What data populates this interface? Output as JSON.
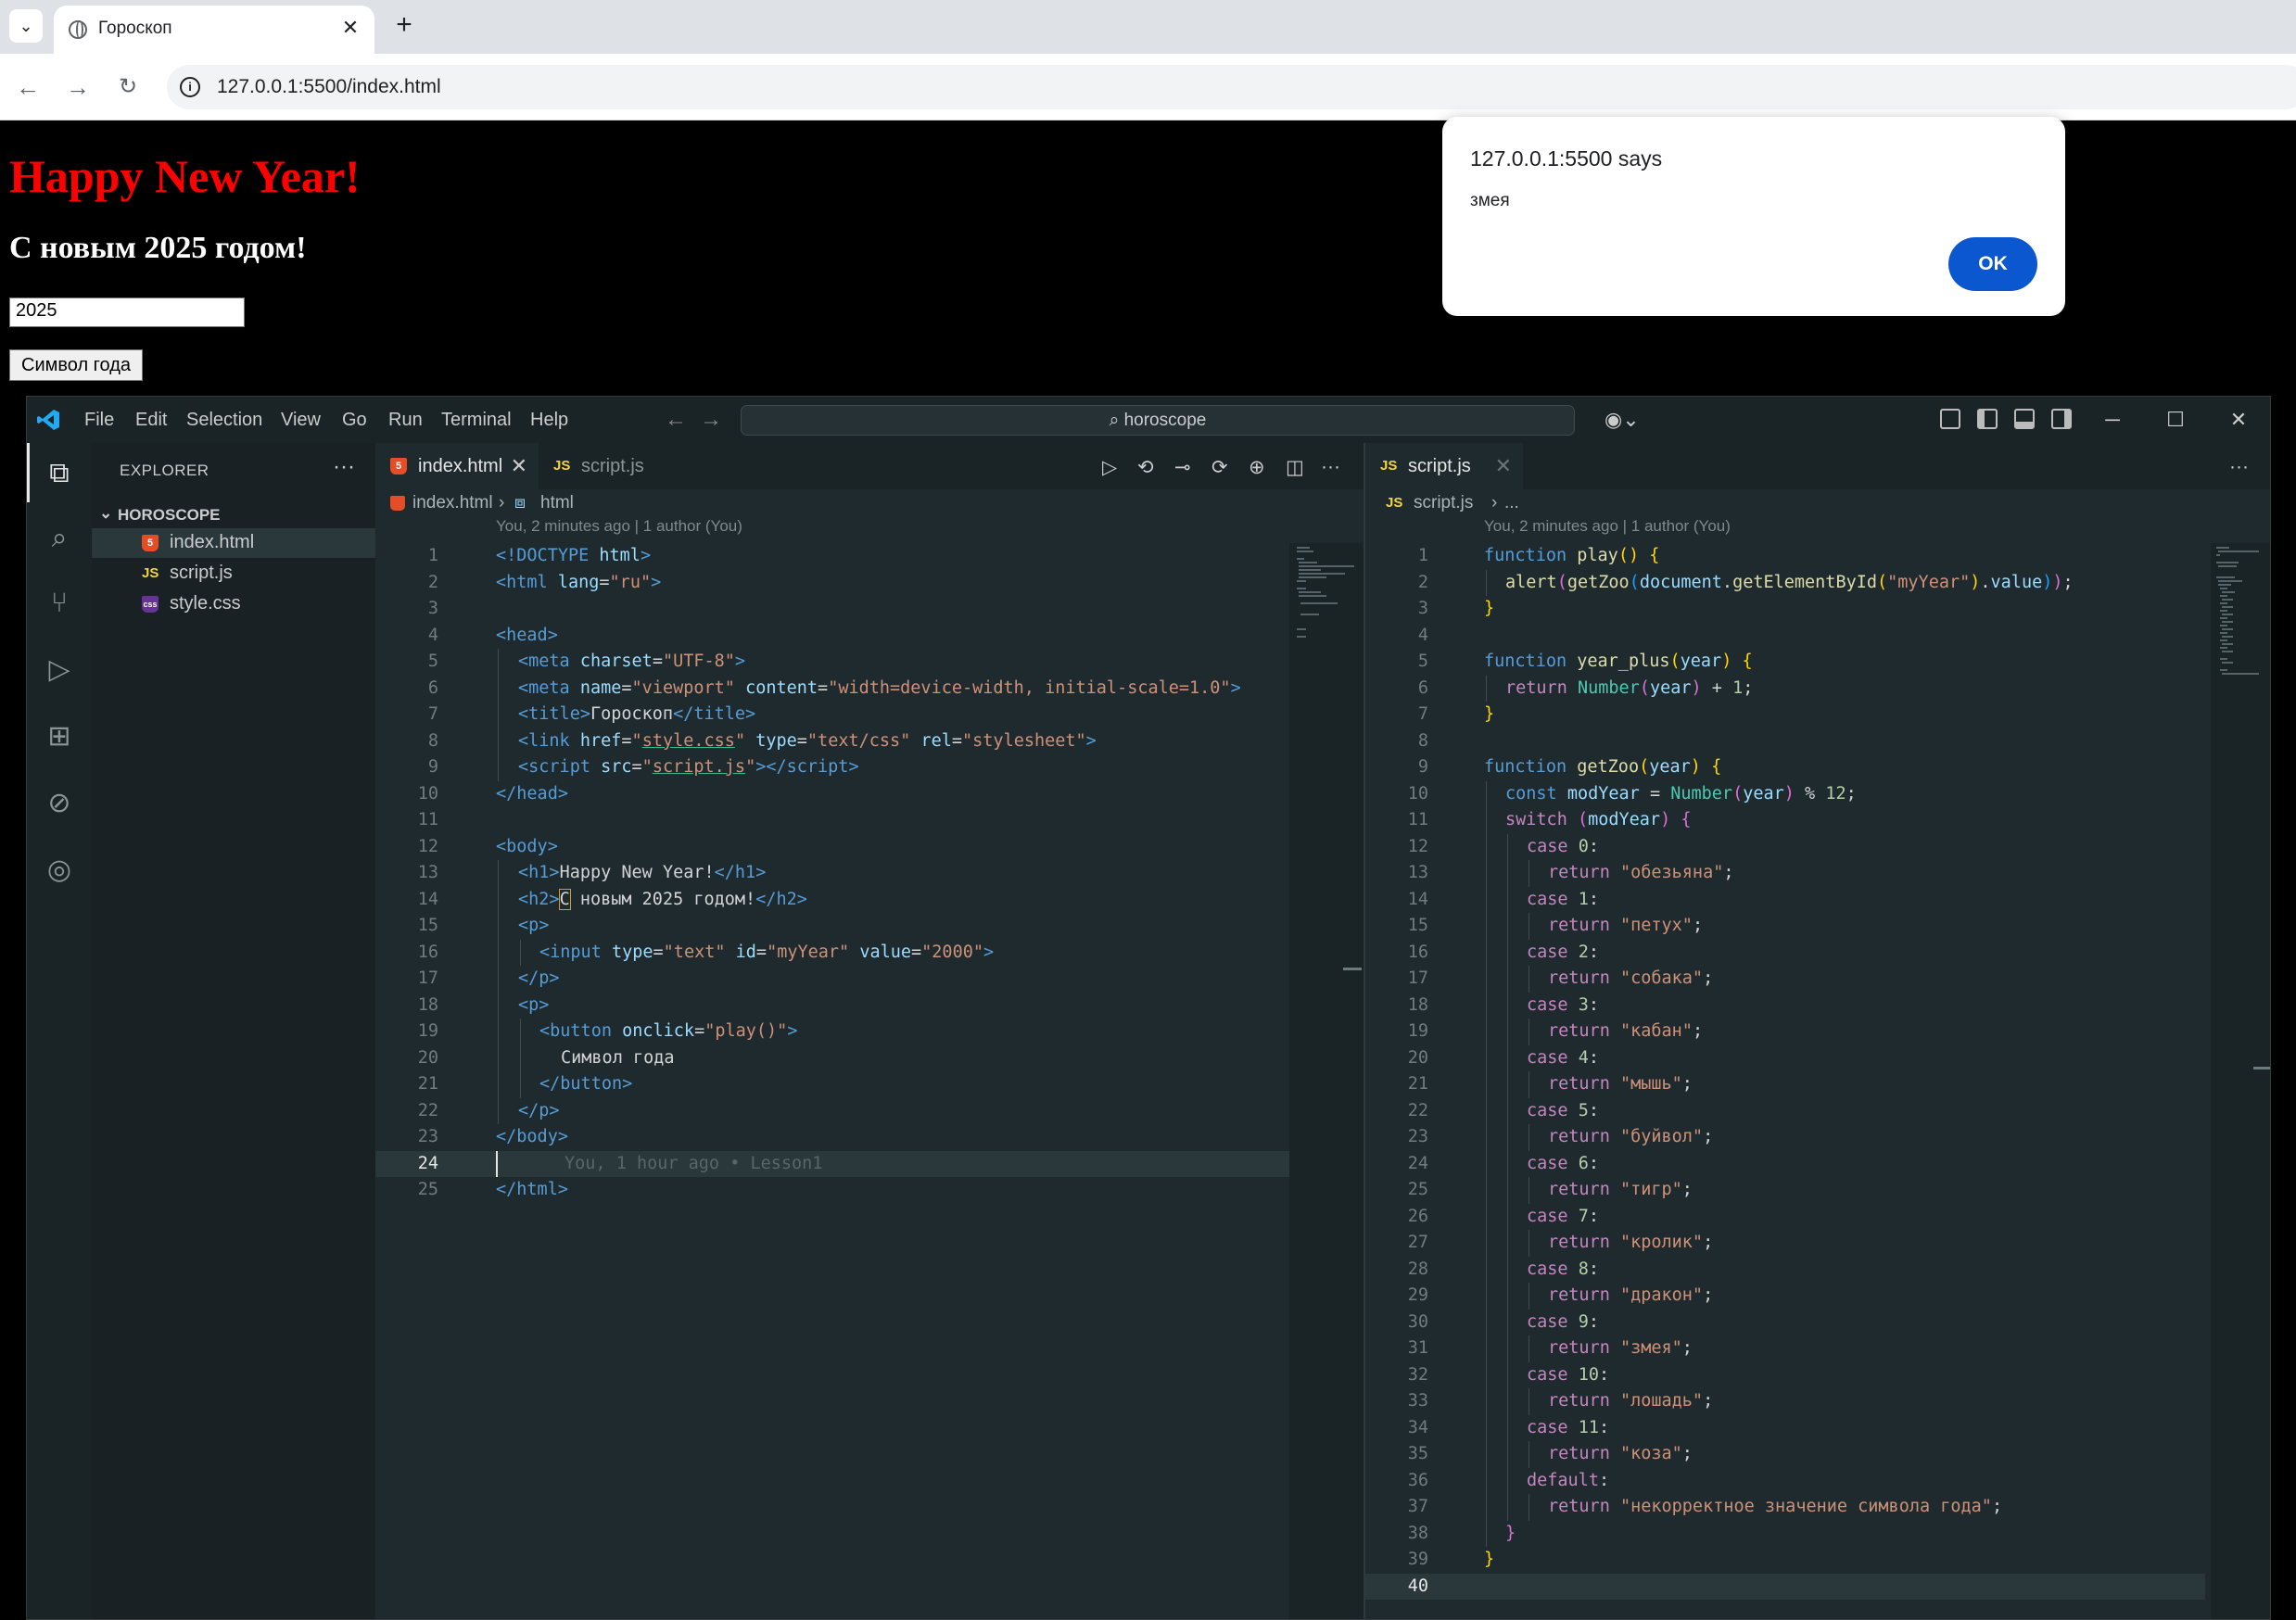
{
  "browser": {
    "tab_title": "Гороскоп",
    "url": "127.0.0.1:5500/index.html"
  },
  "page": {
    "h1": "Happy New Year!",
    "h2": "С новым 2025 годом!",
    "input_value": "2025",
    "button_label": "Символ года"
  },
  "alert": {
    "title": "127.0.0.1:5500 says",
    "message": "змея",
    "ok_label": "OK"
  },
  "vscode": {
    "menu": [
      "File",
      "Edit",
      "Selection",
      "View",
      "Go",
      "Run",
      "Terminal",
      "Help"
    ],
    "search": "horoscope",
    "explorer": {
      "header": "EXPLORER",
      "folder": "HOROSCOPE",
      "files": [
        {
          "name": "index.html",
          "type": "html"
        },
        {
          "name": "script.js",
          "type": "js"
        },
        {
          "name": "style.css",
          "type": "css"
        }
      ]
    },
    "left_editor": {
      "tabs": [
        "index.html",
        "script.js"
      ],
      "breadcrumb": [
        "index.html",
        "html"
      ],
      "blame": "You, 2 minutes ago | 1 author (You)",
      "current_line": 24,
      "inline_blame": "You, 1 hour ago • Lesson1"
    },
    "right_editor": {
      "tabs": [
        "script.js"
      ],
      "breadcrumb": [
        "script.js",
        "..."
      ],
      "blame": "You, 2 minutes ago | 1 author (You)",
      "current_line": 40
    },
    "colors": {
      "accent": "#0b57d0",
      "editor_bg": "#1f2a2e",
      "heading_red": "#ff0000"
    }
  }
}
